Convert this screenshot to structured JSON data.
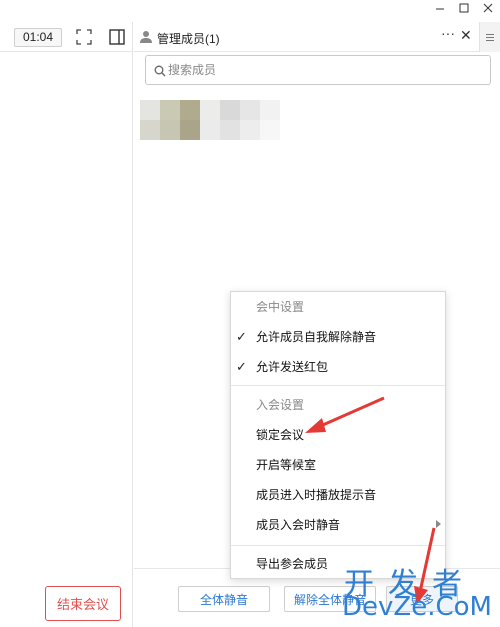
{
  "window": {
    "min_icon": "minimize-icon",
    "max_icon": "maximize-icon",
    "close_icon": "close-icon"
  },
  "toolbar": {
    "timer": "01:04",
    "fullscreen_icon": "fullscreen-icon",
    "sidebar_icon": "sidebar-toggle-icon"
  },
  "panel": {
    "title": "管理成员(1)",
    "more": "···",
    "close": "✕",
    "search_placeholder": "搜索成员"
  },
  "footer": {
    "end_meeting": "结束会议",
    "mute_all": "全体静音",
    "unmute_all": "解除全体静音",
    "more": "更多"
  },
  "context_menu": {
    "section_in_meeting": "会中设置",
    "allow_self_unmute": "允许成员自我解除静音",
    "allow_red_packet": "允许发送红包",
    "section_join": "入会设置",
    "lock_meeting": "锁定会议",
    "waiting_room": "开启等候室",
    "join_sound": "成员进入时播放提示音",
    "mute_on_join": "成员入会时静音",
    "export_members": "导出参会成员"
  },
  "watermark": {
    "line1": "开发者",
    "line2": "DevZe.CoM"
  },
  "colors": {
    "accent_blue": "#2a79d6",
    "danger_red": "#e0504e",
    "annotation_red": "#e53935"
  }
}
